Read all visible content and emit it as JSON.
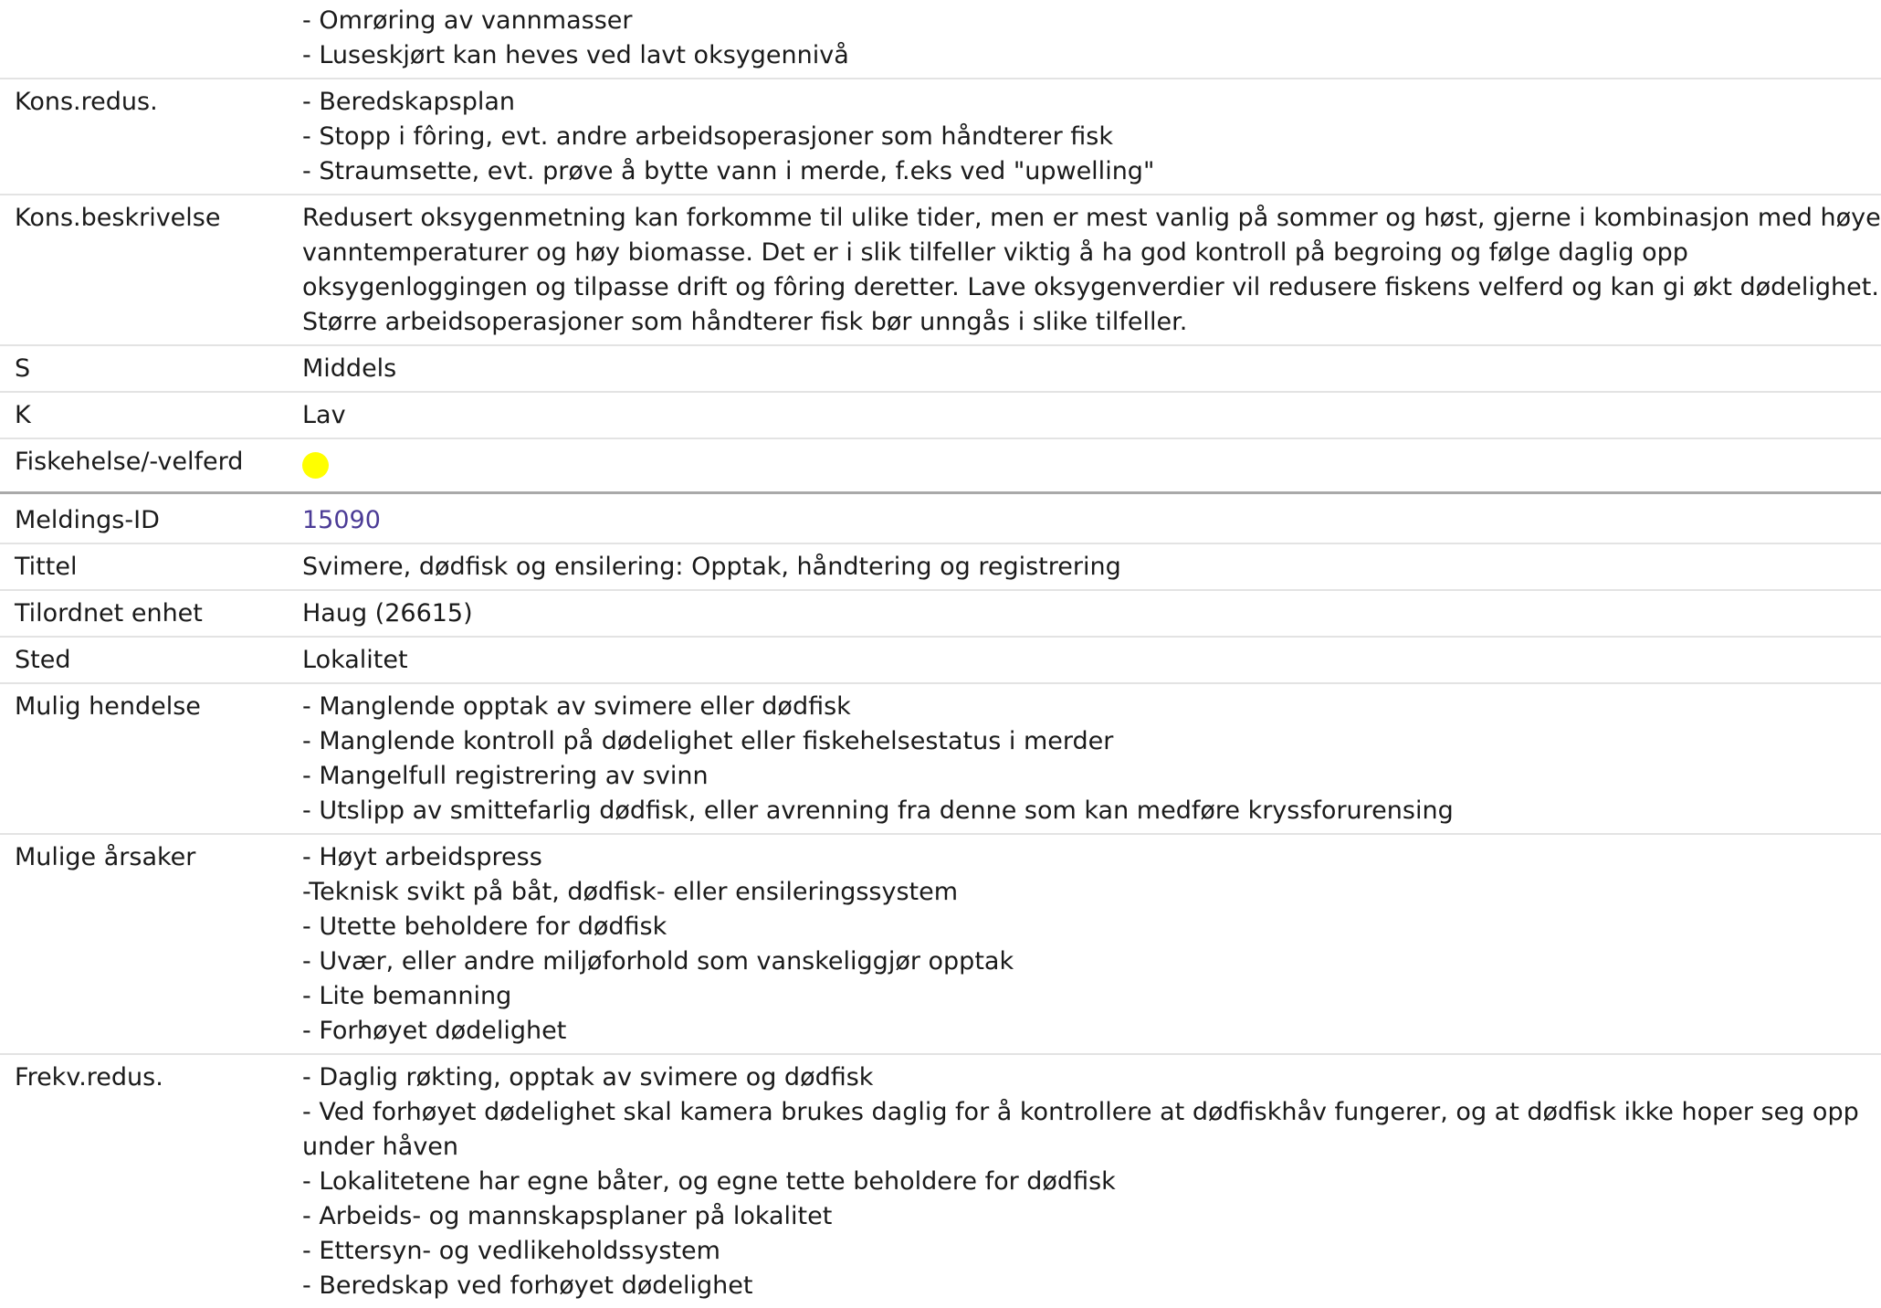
{
  "record1": {
    "continued_lines": [
      "- Omrøring av vannmasser",
      "- Luseskjørt kan heves ved lavt oksygennivå"
    ],
    "rows": [
      {
        "label": "Kons.redus.",
        "lines": [
          "- Beredskapsplan",
          "- Stopp i fôring, evt. andre arbeidsoperasjoner som håndterer fisk",
          "- Straumsette, evt. prøve å bytte vann i merde, f.eks ved \"upwelling\""
        ]
      },
      {
        "label": "Kons.beskrivelse",
        "text": "Redusert oksygenmetning kan forkomme til ulike tider, men er mest vanlig på sommer og høst, gjerne i kombinasjon med høye vanntemperaturer og høy biomasse. Det er i slik tilfeller viktig å ha god kontroll på begroing og følge daglig opp oksygenloggingen og tilpasse drift og fôring deretter. Lave oksygenverdier vil redusere fiskens velferd og kan gi økt dødelighet. Større arbeidsoperasjoner som håndterer fisk bør unngås i slike tilfeller."
      },
      {
        "label": "S",
        "text": "Middels"
      },
      {
        "label": "K",
        "text": "Lav"
      },
      {
        "label": "Fiskehelse/-velferd",
        "indicator_color": "#ffff00"
      }
    ]
  },
  "record2": {
    "id_label": "Meldings-ID",
    "id_value": "15090",
    "rows": [
      {
        "label": "Tittel",
        "text": "Svimere, dødfisk og ensilering: Opptak, håndtering og registrering"
      },
      {
        "label": "Tilordnet enhet",
        "text": "Haug (26615)"
      },
      {
        "label": "Sted",
        "text": "Lokalitet"
      },
      {
        "label": "Mulig hendelse",
        "lines": [
          "- Manglende opptak av svimere eller dødfisk",
          "- Manglende kontroll på dødelighet eller fiskehelsestatus i merder",
          "- Mangelfull registrering av svinn",
          "- Utslipp av smittefarlig dødfisk, eller avrenning fra denne som kan medføre kryssforurensing"
        ]
      },
      {
        "label": "Mulige årsaker",
        "lines": [
          "- Høyt arbeidspress",
          "-Teknisk svikt på båt, dødfisk- eller ensileringssystem",
          "- Utette beholdere for dødfisk",
          "- Uvær, eller andre miljøforhold som vanskeliggjør opptak",
          "- Lite bemanning",
          "- Forhøyet dødelighet"
        ]
      },
      {
        "label": "Frekv.redus.",
        "lines": [
          "- Daglig røkting, opptak av svimere og dødfisk",
          "- Ved forhøyet dødelighet skal kamera brukes daglig for å kontrollere at dødfiskhåv fungerer, og at dødfisk ikke hoper seg opp under håven",
          "- Lokalitetene har egne båter, og egne tette beholdere for dødfisk",
          "- Arbeids- og mannskapsplaner på lokalitet",
          "- Ettersyn- og vedlikeholdssystem",
          "- Beredskap ved forhøyet dødelighet"
        ]
      }
    ]
  }
}
